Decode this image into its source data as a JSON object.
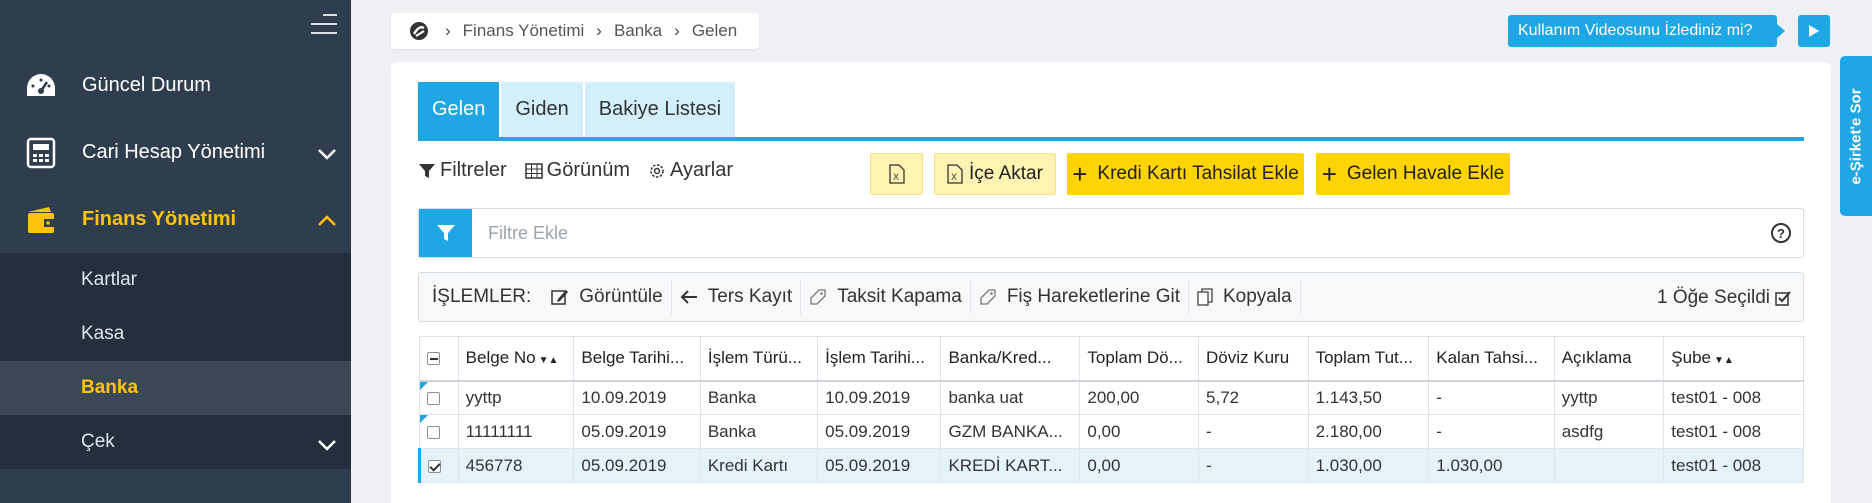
{
  "sidebar": {
    "items": [
      {
        "label": "Güncel Durum",
        "icon": "dashboard-icon"
      },
      {
        "label": "Cari Hesap Yönetimi",
        "icon": "calculator-icon"
      },
      {
        "label": "Finans Yönetimi",
        "icon": "wallet-icon"
      }
    ],
    "subitems": [
      {
        "label": "Kartlar"
      },
      {
        "label": "Kasa"
      },
      {
        "label": "Banka"
      },
      {
        "label": "Çek"
      }
    ]
  },
  "breadcrumb": {
    "items": [
      "Finans Yönetimi",
      "Banka",
      "Gelen"
    ]
  },
  "video_help": {
    "label": "Kullanım Videosunu İzlediniz mi?"
  },
  "side_tab": {
    "label": "e-Şirket'e Sor"
  },
  "tabs": [
    "Gelen",
    "Giden",
    "Bakiye Listesi"
  ],
  "toolbar": {
    "filters": "Filtreler",
    "view": "Görünüm",
    "settings": "Ayarlar",
    "import": "İçe Aktar",
    "add_card": "Kredi Kartı Tahsilat Ekle",
    "add_transfer": "Gelen Havale Ekle"
  },
  "filter": {
    "placeholder": "Filtre Ekle",
    "help": "?"
  },
  "operations": {
    "label": "İŞLEMLER:",
    "view": "Görüntüle",
    "reverse": "Ters Kayıt",
    "installment": "Taksit Kapama",
    "receipt": "Fiş Hareketlerine Git",
    "copy": "Kopyala",
    "selected": "1 Öğe Seçildi"
  },
  "table": {
    "headers": [
      "Belge No",
      "Belge Tarihi...",
      "İşlem Türü...",
      "İşlem Tarihi...",
      "Banka/Kred...",
      "Toplam Dö...",
      "Döviz Kuru",
      "Toplam Tut...",
      "Kalan Tahsi...",
      "Açıklama",
      "Şube"
    ],
    "rows": [
      {
        "checked": false,
        "cells": [
          "yyttp",
          "10.09.2019",
          "Banka",
          "10.09.2019",
          "banka uat",
          "200,00",
          "5,72",
          "1.143,50",
          "-",
          "yyttp",
          "test01 - 008"
        ]
      },
      {
        "checked": false,
        "cells": [
          "11111111",
          "05.09.2019",
          "Banka",
          "05.09.2019",
          "GZM BANKA...",
          "0,00",
          "-",
          "2.180,00",
          "-",
          "asdfg",
          "test01 - 008"
        ]
      },
      {
        "checked": true,
        "cells": [
          "456778",
          "05.09.2019",
          "Kredi Kartı",
          "05.09.2019",
          "KREDİ KART...",
          "0,00",
          "-",
          "1.030,00",
          "1.030,00",
          "",
          "test01 - 008"
        ]
      }
    ]
  },
  "colors": {
    "sidebar": "#2f3e4e",
    "accent": "#1ea7e4",
    "active": "#ffc20e",
    "button": "#ffd400"
  }
}
